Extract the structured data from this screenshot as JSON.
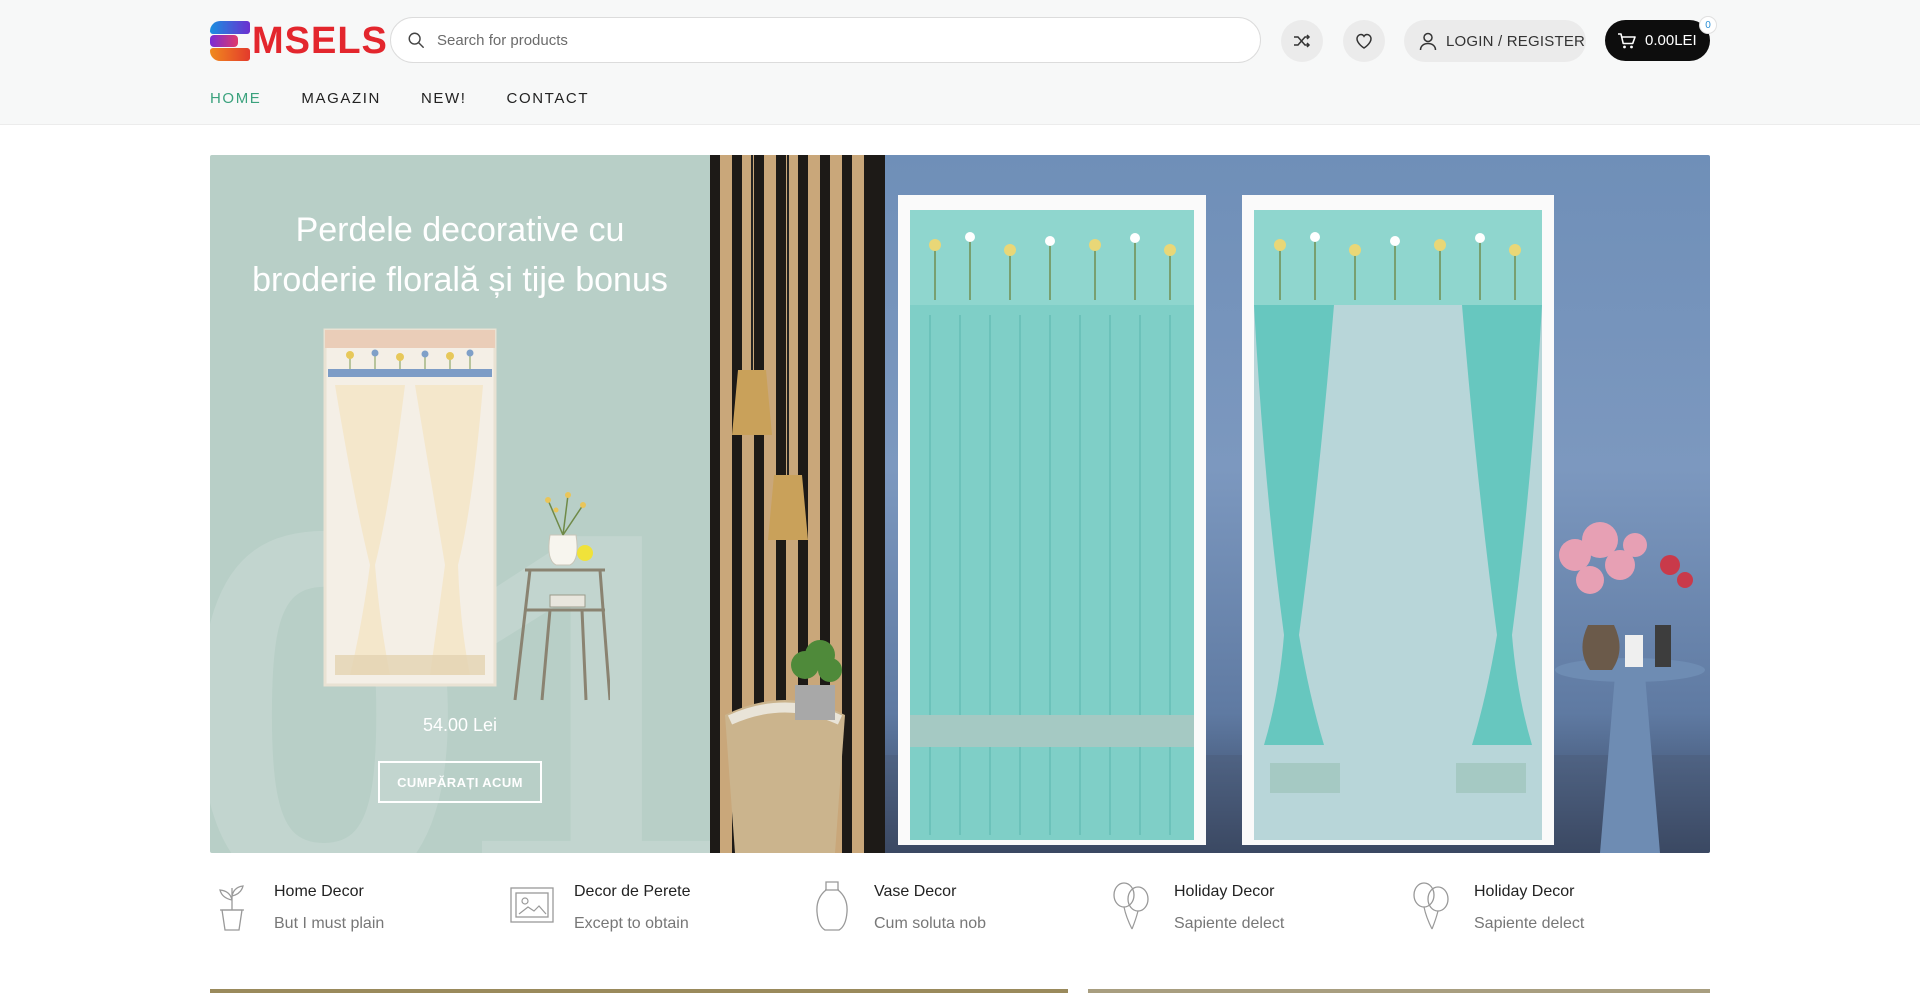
{
  "brand": {
    "name": "MSELS"
  },
  "search": {
    "placeholder": "Search for products"
  },
  "header": {
    "login_label": "LOGIN / REGISTER",
    "cart_total": "0.00LEI",
    "cart_count": "0"
  },
  "nav": {
    "items": [
      {
        "label": "HOME",
        "active": true
      },
      {
        "label": "MAGAZIN"
      },
      {
        "label": "NEW!"
      },
      {
        "label": "CONTACT"
      }
    ]
  },
  "hero": {
    "title_line1": "Perdele decorative cu",
    "title_line2": "broderie florală și tije bonus",
    "price": "54.00 Lei",
    "cta": "CUMPĂRAȚI ACUM",
    "big_number": "01.",
    "bg_color": "#b8cfc7"
  },
  "features": [
    {
      "title": "Home Decor",
      "subtitle": "But I must plain",
      "icon": "plant-pot-icon"
    },
    {
      "title": "Decor de Perete",
      "subtitle": "Except to obtain",
      "icon": "wall-frame-icon"
    },
    {
      "title": "Vase Decor",
      "subtitle": "Cum soluta nob",
      "icon": "vase-icon"
    },
    {
      "title": "Holiday Decor",
      "subtitle": "Sapiente delect",
      "icon": "balloons-icon"
    },
    {
      "title": "Holiday Decor",
      "subtitle": "Sapiente delect",
      "icon": "balloons-icon"
    }
  ],
  "colors": {
    "accent": "#3aa27d",
    "logo_red": "#e3262d",
    "cart_bg": "#0d0d0d"
  }
}
